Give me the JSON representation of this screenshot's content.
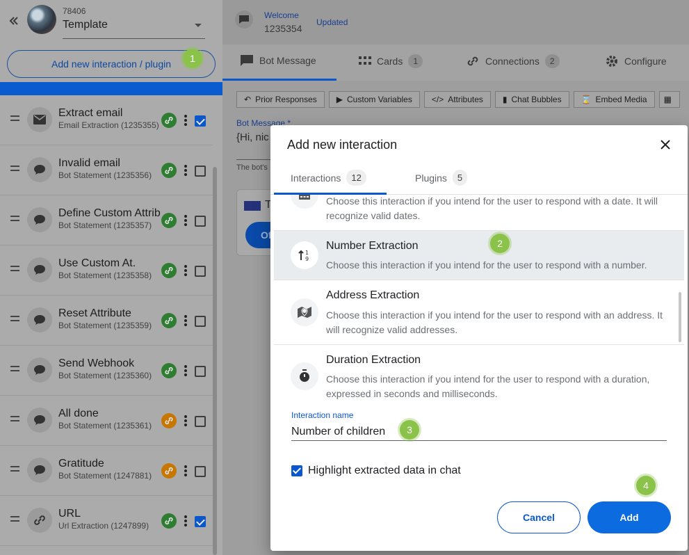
{
  "sidebar": {
    "template_id": "78406",
    "template_name": "Template",
    "add_button_label": "Add new interaction / plugin",
    "items": [
      {
        "title": "Extract email",
        "subtitle": "Email Extraction (1235355)",
        "icon": "envelope-icon",
        "link_color": "green",
        "checked": true
      },
      {
        "title": "Invalid email",
        "subtitle": "Bot Statement (1235356)",
        "icon": "chat-bubble-icon",
        "link_color": "green",
        "checked": false
      },
      {
        "title": "Define Custom Attrib",
        "subtitle": "Bot Statement (1235357)",
        "icon": "chat-bubble-icon",
        "link_color": "green",
        "checked": false
      },
      {
        "title": "Use Custom At.",
        "subtitle": "Bot Statement (1235358)",
        "icon": "chat-bubble-icon",
        "link_color": "green",
        "checked": false
      },
      {
        "title": "Reset Attribute",
        "subtitle": "Bot Statement (1235359)",
        "icon": "chat-bubble-icon",
        "link_color": "green",
        "checked": false
      },
      {
        "title": "Send Webhook",
        "subtitle": "Bot Statement (1235360)",
        "icon": "chat-bubble-icon",
        "link_color": "green",
        "checked": false
      },
      {
        "title": "All done",
        "subtitle": "Bot Statement (1235361)",
        "icon": "chat-bubble-icon",
        "link_color": "orange",
        "checked": false
      },
      {
        "title": "Gratitude",
        "subtitle": "Bot Statement (1247881)",
        "icon": "chat-bubble-icon",
        "link_color": "orange",
        "checked": false
      },
      {
        "title": "URL",
        "subtitle": "Url Extraction (1247899)",
        "icon": "link-icon",
        "link_color": "green",
        "checked": true
      }
    ]
  },
  "main": {
    "welcome_label": "Welcome",
    "interaction_id": "1235354",
    "updated_label": "Updated",
    "tabs": [
      {
        "label": "Bot Message",
        "count": null,
        "icon": "message-icon"
      },
      {
        "label": "Cards",
        "count": "1",
        "icon": "grid-icon"
      },
      {
        "label": "Connections",
        "count": "2",
        "icon": "link-icon"
      },
      {
        "label": "Configure",
        "count": null,
        "icon": "gear-icon"
      }
    ],
    "toolbar": [
      {
        "label": "Prior Responses",
        "icon": "reply-icon"
      },
      {
        "label": "Custom Variables",
        "icon": "play-box-icon"
      },
      {
        "label": "Attributes",
        "icon": "code-icon"
      },
      {
        "label": "Chat Bubbles",
        "icon": "chat-bubble-icon"
      },
      {
        "label": "Embed Media",
        "icon": "paperclip-icon"
      }
    ],
    "bot_message_label": "Bot Message *",
    "bot_message_value": "{Hi, nic",
    "bot_message_help": "The bot's",
    "card_letter": "T",
    "card_button_text": "Of"
  },
  "modal": {
    "title": "Add new interaction",
    "tabs": [
      {
        "label": "Interactions",
        "count": "12",
        "active": true
      },
      {
        "label": "Plugins",
        "count": "5",
        "active": false
      }
    ],
    "options": [
      {
        "title": "",
        "description": "Choose this interaction if you intend for the user to respond with a date. It will recognize valid dates.",
        "icon": "calendar-icon",
        "selected": false
      },
      {
        "title": "Number Extraction",
        "description": "Choose this interaction if you intend for the user to respond with a number.",
        "icon": "number-sort-icon",
        "selected": true
      },
      {
        "title": "Address Extraction",
        "description": "Choose this interaction if you intend for the user to respond with an address. It will recognize valid addresses.",
        "icon": "map-pin-icon",
        "selected": false
      },
      {
        "title": "Duration Extraction",
        "description": "Choose this interaction if you intend for the user to respond with a duration, expressed in seconds and milliseconds.",
        "icon": "stopwatch-icon",
        "selected": false
      }
    ],
    "name_field_label": "Interaction name",
    "name_field_value": "Number of children",
    "highlight_label": "Highlight extracted data in chat",
    "highlight_checked": true,
    "cancel_label": "Cancel",
    "add_label": "Add"
  },
  "badges": [
    "1",
    "2",
    "3",
    "4"
  ],
  "colors": {
    "primary": "#0b57d0",
    "badge": "#8bc34a",
    "link_green": "#2e7d32",
    "link_orange": "#c77700"
  }
}
